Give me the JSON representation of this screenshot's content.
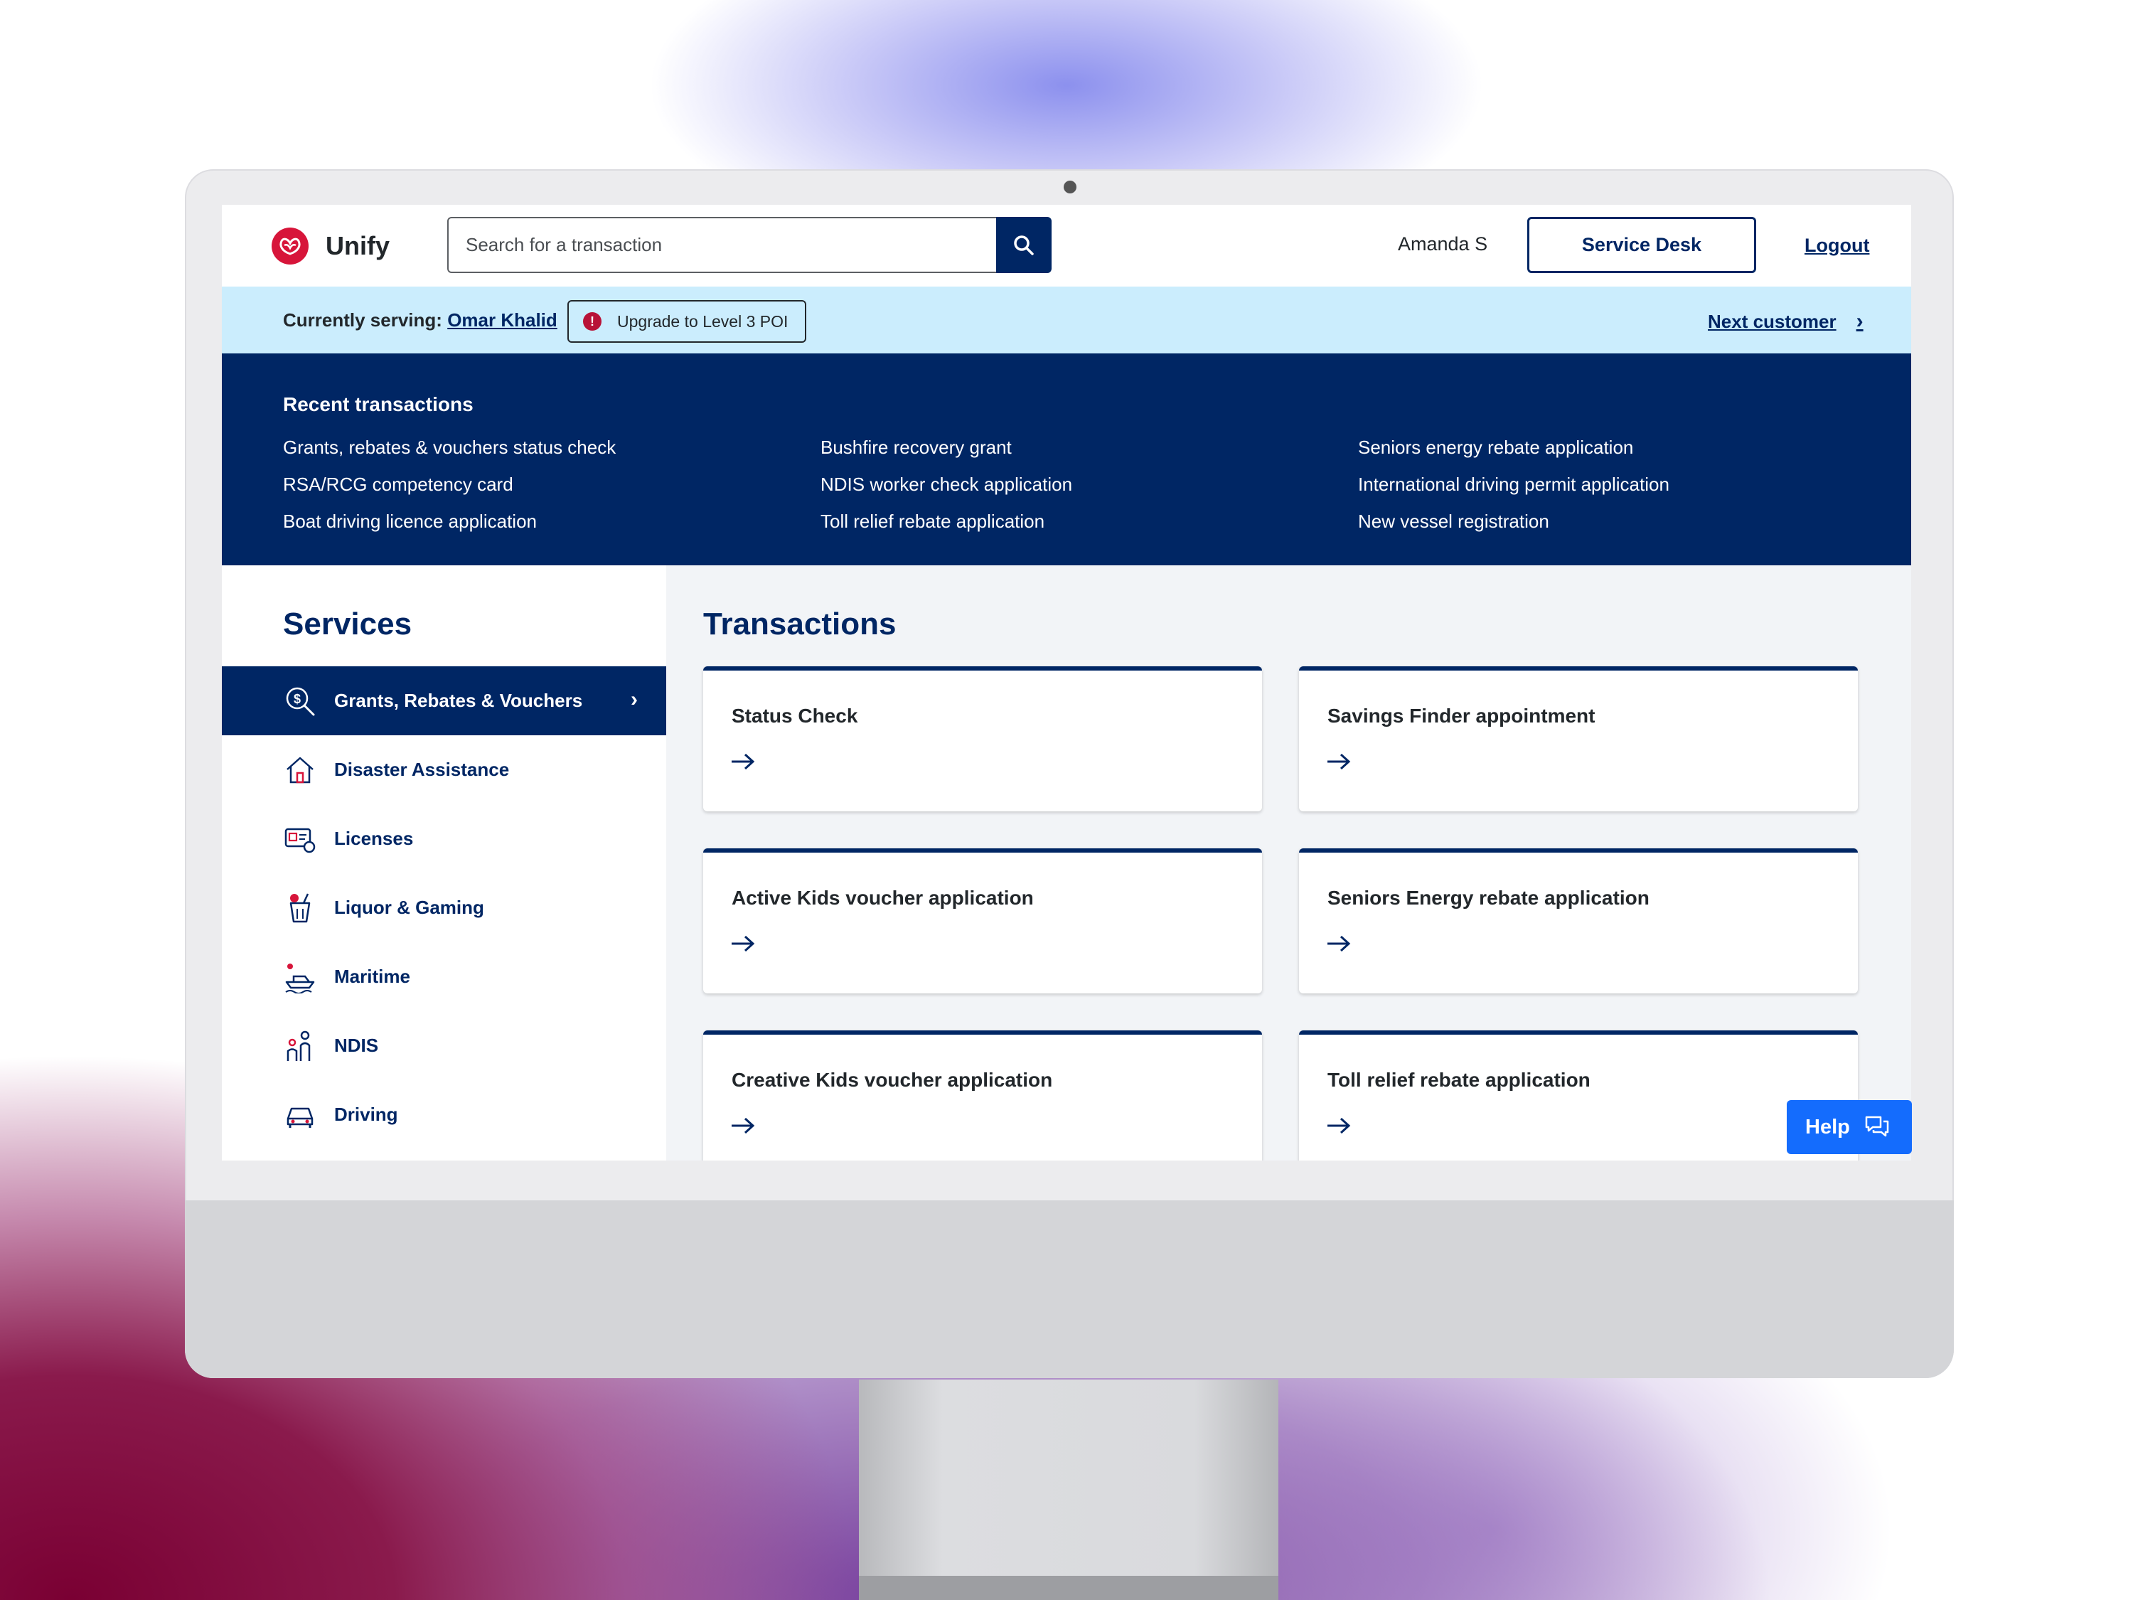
{
  "app": {
    "name": "Unify"
  },
  "header": {
    "search_placeholder": "Search for a transaction",
    "user_name": "Amanda S",
    "service_desk_label": "Service Desk",
    "logout_label": "Logout"
  },
  "serving": {
    "prefix": "Currently serving:",
    "customer_name": "Omar Khalid",
    "upgrade_label": "Upgrade to Level 3 POI",
    "next_label": "Next customer"
  },
  "recent": {
    "title": "Recent transactions",
    "items": [
      "Grants, rebates & vouchers status check",
      "Bushfire recovery grant",
      "Seniors energy rebate application",
      "RSA/RCG competency card",
      "NDIS worker check application",
      "International driving permit application",
      "Boat driving licence application",
      "Toll relief rebate application",
      "New vessel registration"
    ]
  },
  "services": {
    "title": "Services",
    "items": [
      {
        "label": "Grants, Rebates & Vouchers",
        "icon": "dollar-search-icon",
        "active": true
      },
      {
        "label": "Disaster Assistance",
        "icon": "house-icon"
      },
      {
        "label": "Licenses",
        "icon": "license-card-icon"
      },
      {
        "label": "Liquor & Gaming",
        "icon": "drink-icon"
      },
      {
        "label": "Maritime",
        "icon": "boat-icon"
      },
      {
        "label": "NDIS",
        "icon": "people-icon"
      },
      {
        "label": "Driving",
        "icon": "car-icon"
      }
    ]
  },
  "transactions": {
    "title": "Transactions",
    "cards": [
      {
        "label": "Status Check"
      },
      {
        "label": "Savings Finder appointment"
      },
      {
        "label": "Active Kids voucher application"
      },
      {
        "label": "Seniors Energy rebate application"
      },
      {
        "label": "Creative Kids voucher application"
      },
      {
        "label": "Toll relief rebate application"
      }
    ]
  },
  "help": {
    "label": "Help"
  },
  "colors": {
    "primary": "#002664",
    "accent_red": "#d7153a",
    "serving_bg": "#cbedfd",
    "help_blue": "#146cfd"
  }
}
